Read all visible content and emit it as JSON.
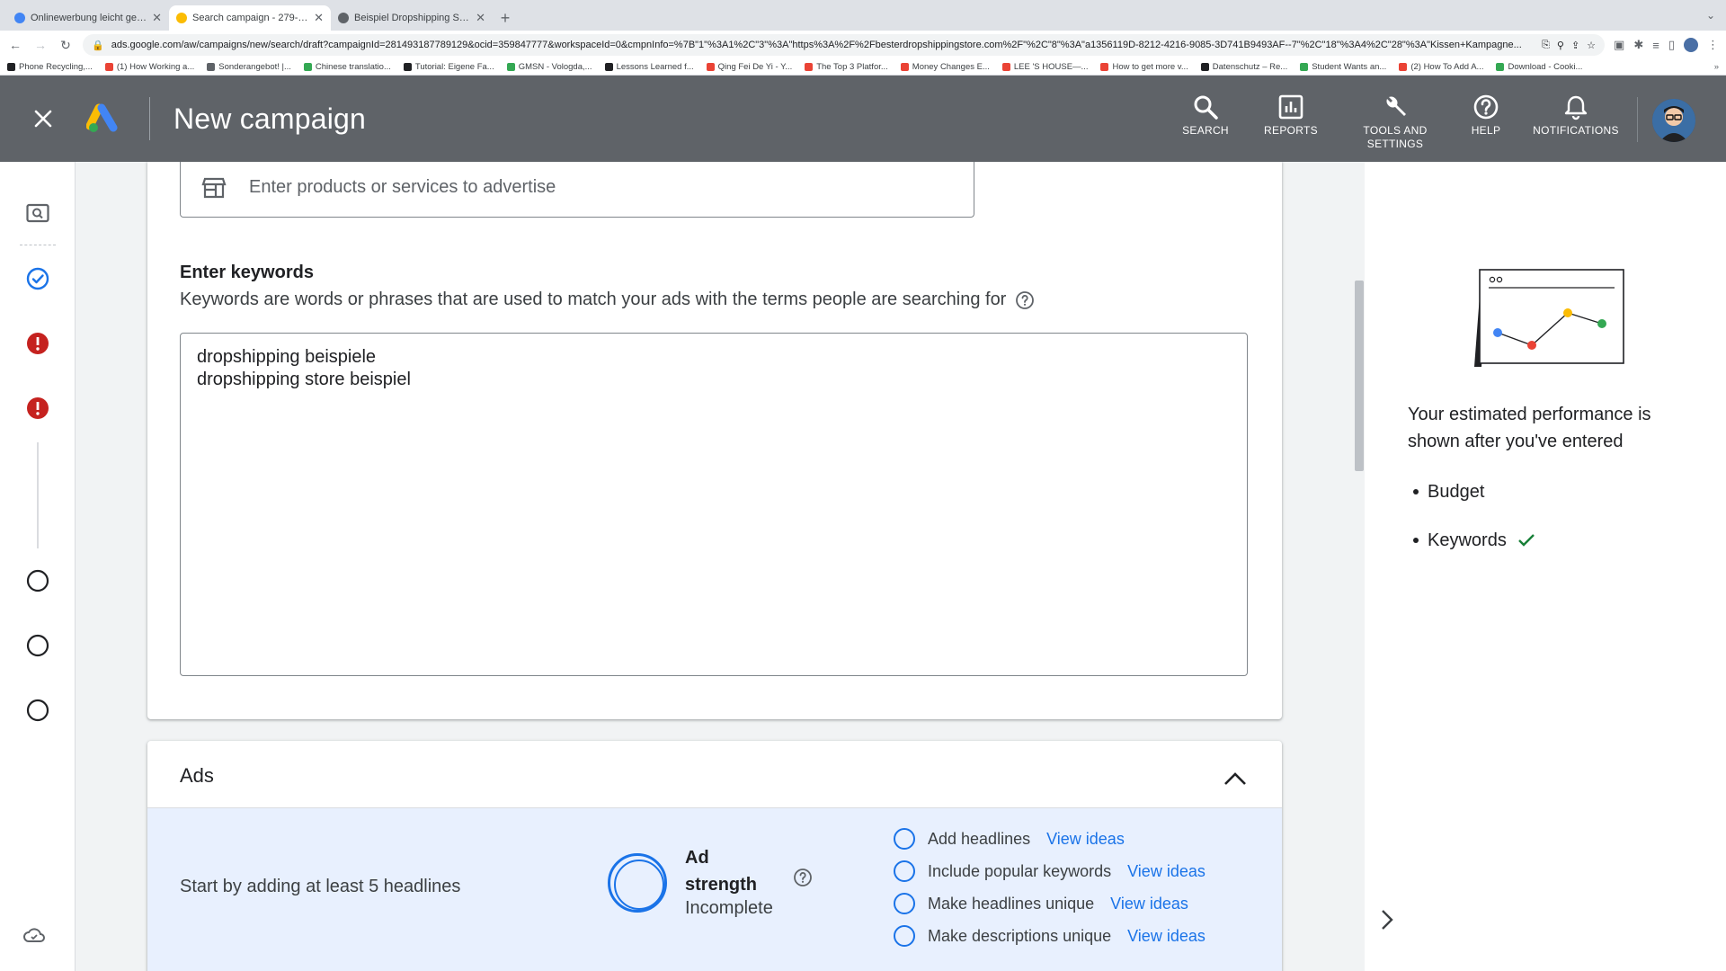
{
  "browser": {
    "tabs": [
      {
        "title": "Onlinewerbung leicht gemacht",
        "active": false,
        "color": "#4285f4"
      },
      {
        "title": "Search campaign - 279-560-1",
        "active": true,
        "color": "#fbbc04"
      },
      {
        "title": "Beispiel Dropshipping Store",
        "active": false,
        "color": "#5f6368"
      }
    ],
    "url": "ads.google.com/aw/campaigns/new/search/draft?campaignId=281493187789129&ocid=359847777&workspaceId=0&cmpnInfo=%7B\"1\"%3A1%2C\"3\"%3A\"https%3A%2F%2Fbesterdropshippingstore.com%2F\"%2C\"8\"%3A\"a1356119D-8212-4216-9085-3D741B9493AF--7\"%2C\"18\"%3A4%2C\"28\"%3A\"Kissen+Kampagne...",
    "bookmarks": [
      {
        "label": "Phone Recycling,...",
        "color": "#202124"
      },
      {
        "label": "(1) How Working a...",
        "color": "#ea4335"
      },
      {
        "label": "Sonderangebot! |...",
        "color": "#5f6368"
      },
      {
        "label": "Chinese translatio...",
        "color": "#34a853"
      },
      {
        "label": "Tutorial: Eigene Fa...",
        "color": "#202124"
      },
      {
        "label": "GMSN - Vologda,...",
        "color": "#34a853"
      },
      {
        "label": "Lessons Learned f...",
        "color": "#202124"
      },
      {
        "label": "Qing Fei De Yi - Y...",
        "color": "#ea4335"
      },
      {
        "label": "The Top 3 Platfor...",
        "color": "#ea4335"
      },
      {
        "label": "Money Changes E...",
        "color": "#ea4335"
      },
      {
        "label": "LEE 'S HOUSE—...",
        "color": "#ea4335"
      },
      {
        "label": "How to get more v...",
        "color": "#ea4335"
      },
      {
        "label": "Datenschutz – Re...",
        "color": "#202124"
      },
      {
        "label": "Student Wants an...",
        "color": "#34a853"
      },
      {
        "label": "(2) How To Add A...",
        "color": "#ea4335"
      },
      {
        "label": "Download - Cooki...",
        "color": "#34a853"
      }
    ]
  },
  "header": {
    "title": "New campaign",
    "actions": {
      "search": "SEARCH",
      "reports": "REPORTS",
      "tools_line1": "TOOLS AND",
      "tools_line2": "SETTINGS",
      "help": "HELP",
      "notifications": "NOTIFICATIONS"
    },
    "bg_color": "#5f6368"
  },
  "keywords_section": {
    "product_placeholder": "Enter products or services to advertise",
    "title": "Enter keywords",
    "description": "Keywords are words or phrases that are used to match your ads with the terms people are searching for",
    "keywords": [
      "dropshipping beispiele",
      "dropshipping store beispiel"
    ]
  },
  "ads_section": {
    "title": "Ads",
    "hint": "Start by adding at least 5 headlines",
    "strength_label_1": "Ad",
    "strength_label_2": "strength",
    "strength_status": "Incomplete",
    "checklist": [
      {
        "label": "Add headlines",
        "link": "View ideas"
      },
      {
        "label": "Include popular keywords",
        "link": "View ideas"
      },
      {
        "label": "Make headlines unique",
        "link": "View ideas"
      },
      {
        "label": "Make descriptions unique",
        "link": "View ideas"
      }
    ]
  },
  "right_panel": {
    "text": "Your estimated performance is shown after you've entered",
    "items": [
      {
        "label": "Budget",
        "done": false
      },
      {
        "label": "Keywords",
        "done": true
      }
    ]
  },
  "colors": {
    "accent": "#1a73e8",
    "error": "#c5221f",
    "success": "#188038"
  }
}
